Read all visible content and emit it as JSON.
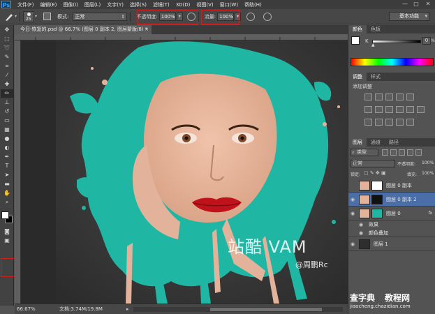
{
  "menubar": {
    "logo": "Ps",
    "items": [
      "文件(F)",
      "编辑(E)",
      "图像(I)",
      "图层(L)",
      "文字(Y)",
      "选择(S)",
      "滤镜(T)",
      "3D(D)",
      "视图(V)",
      "窗口(W)",
      "帮助(H)"
    ],
    "minimize": "—",
    "maximize": "□",
    "close": "✕"
  },
  "options": {
    "brush_size": "25",
    "mode_label": "模式:",
    "mode_value": "正常",
    "opacity_label": "不透明度:",
    "opacity_value": "100%",
    "flow_label": "流量:",
    "flow_value": "100%",
    "workspace": "基本功能"
  },
  "document": {
    "tab_title": "今日-恢复的.psd @ 66.7% (图层 0 副本 2, 图层蒙版/8) *",
    "zoom": "66.67%",
    "doc_info": "文档:3.74M/19.8M"
  },
  "canvas": {
    "watermark": "站酷 VAM",
    "signature": "@周鹏Rc"
  },
  "color_panel": {
    "tabs": [
      "颜色",
      "色板"
    ],
    "channel": "K",
    "value": "0",
    "unit": "%"
  },
  "adjustments_panel": {
    "tabs": [
      "调整",
      "样式"
    ],
    "title": "添加调整"
  },
  "layers_panel": {
    "tabs": [
      "图层",
      "通道",
      "路径"
    ],
    "filter_label": "类型",
    "blend_mode": "正常",
    "opacity_label": "不透明度:",
    "opacity_value": "100%",
    "lock_label": "锁定:",
    "fill_label": "填充:",
    "fill_value": "100%",
    "layers": [
      {
        "name": "图层 0 副本"
      },
      {
        "name": "图层 0 副本 2"
      },
      {
        "name": "图层 0",
        "fx": "fx"
      },
      {
        "name": "效果"
      },
      {
        "name": "颜色叠加"
      },
      {
        "name": "图层 1"
      }
    ]
  },
  "site_watermark": {
    "brand": "查字典",
    "brand2": "教程网",
    "url": "jiaocheng.chazidian.com"
  },
  "colors": {
    "accent_red": "#d21c1c",
    "teal_paint": "#1fb7a4",
    "skin": "#e2b39a",
    "panel_bg": "#535353",
    "selected_layer": "#4a6ea8"
  }
}
